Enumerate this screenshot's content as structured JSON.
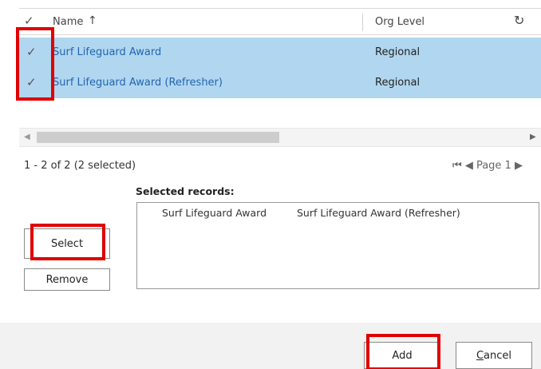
{
  "grid": {
    "header": {
      "check_glyph": "✓",
      "name_label": "Name",
      "sort_glyph": "↑",
      "org_label": "Org Level",
      "refresh_glyph": "↻"
    },
    "rows": [
      {
        "check_glyph": "✓",
        "name": "Surf Lifeguard Award",
        "org": "Regional"
      },
      {
        "check_glyph": "✓",
        "name": "Surf Lifeguard Award (Refresher)",
        "org": "Regional"
      }
    ]
  },
  "scrollbar": {
    "left_glyph": "◀",
    "right_glyph": "▶"
  },
  "status": {
    "record_count": "1 - 2 of 2 (2 selected)",
    "pager": "⏮ ◀ Page 1 ▶"
  },
  "selected_records": {
    "label": "Selected records:",
    "items": [
      "Surf Lifeguard Award",
      "Surf Lifeguard Award (Refresher)"
    ]
  },
  "buttons": {
    "select": "Select",
    "remove": "Remove",
    "add": "Add",
    "cancel_first": "C",
    "cancel_rest": "ancel"
  },
  "colors": {
    "selected_row": "#b1d6f0",
    "link": "#2266b0",
    "highlight": "#e00000"
  }
}
